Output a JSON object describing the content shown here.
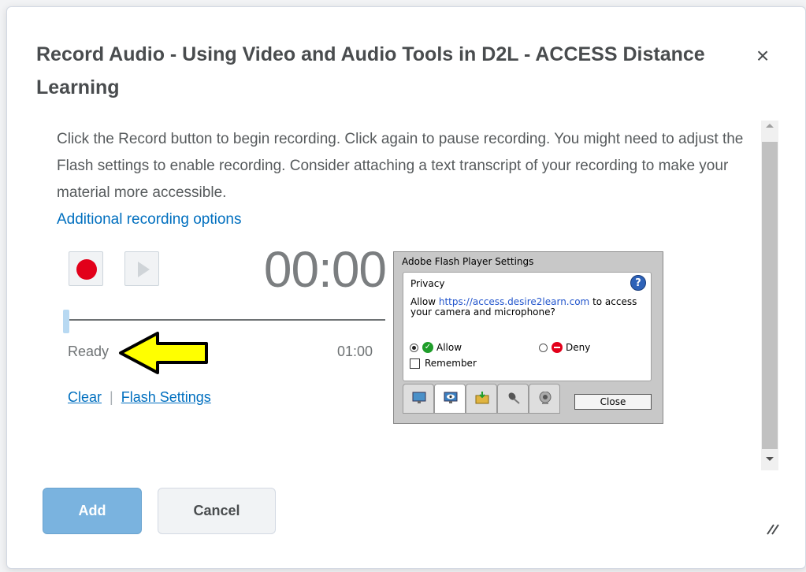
{
  "dialog": {
    "title": "Record Audio - Using Video and Audio Tools in D2L - ACCESS Distance Learning",
    "close_label": "×"
  },
  "content": {
    "description": "Click the Record button to begin recording. Click again to pause recording. You might need to adjust the Flash settings to enable recording. Consider attaching a text transcript of your recording to make your material more accessible.",
    "options_link": "Additional recording options"
  },
  "recorder": {
    "timer": "00:00",
    "status": "Ready",
    "duration": "01:00",
    "progress": 0,
    "clear_link": "Clear",
    "separator": "|",
    "flash_settings_link": "Flash Settings"
  },
  "flash_panel": {
    "title": "Adobe Flash Player Settings",
    "section": "Privacy",
    "help": "?",
    "allow_prefix": "Allow ",
    "url": "https://access.desire2learn.com",
    "allow_suffix": " to access your camera and microphone?",
    "allow_label": "Allow",
    "deny_label": "Deny",
    "remember_label": "Remember",
    "close_label": "Close",
    "selected": "Allow"
  },
  "footer": {
    "add_label": "Add",
    "cancel_label": "Cancel"
  },
  "colors": {
    "link": "#006fbf",
    "primary_button": "#7ab3df",
    "record": "#e2001a",
    "arrow": "#ffff00"
  }
}
